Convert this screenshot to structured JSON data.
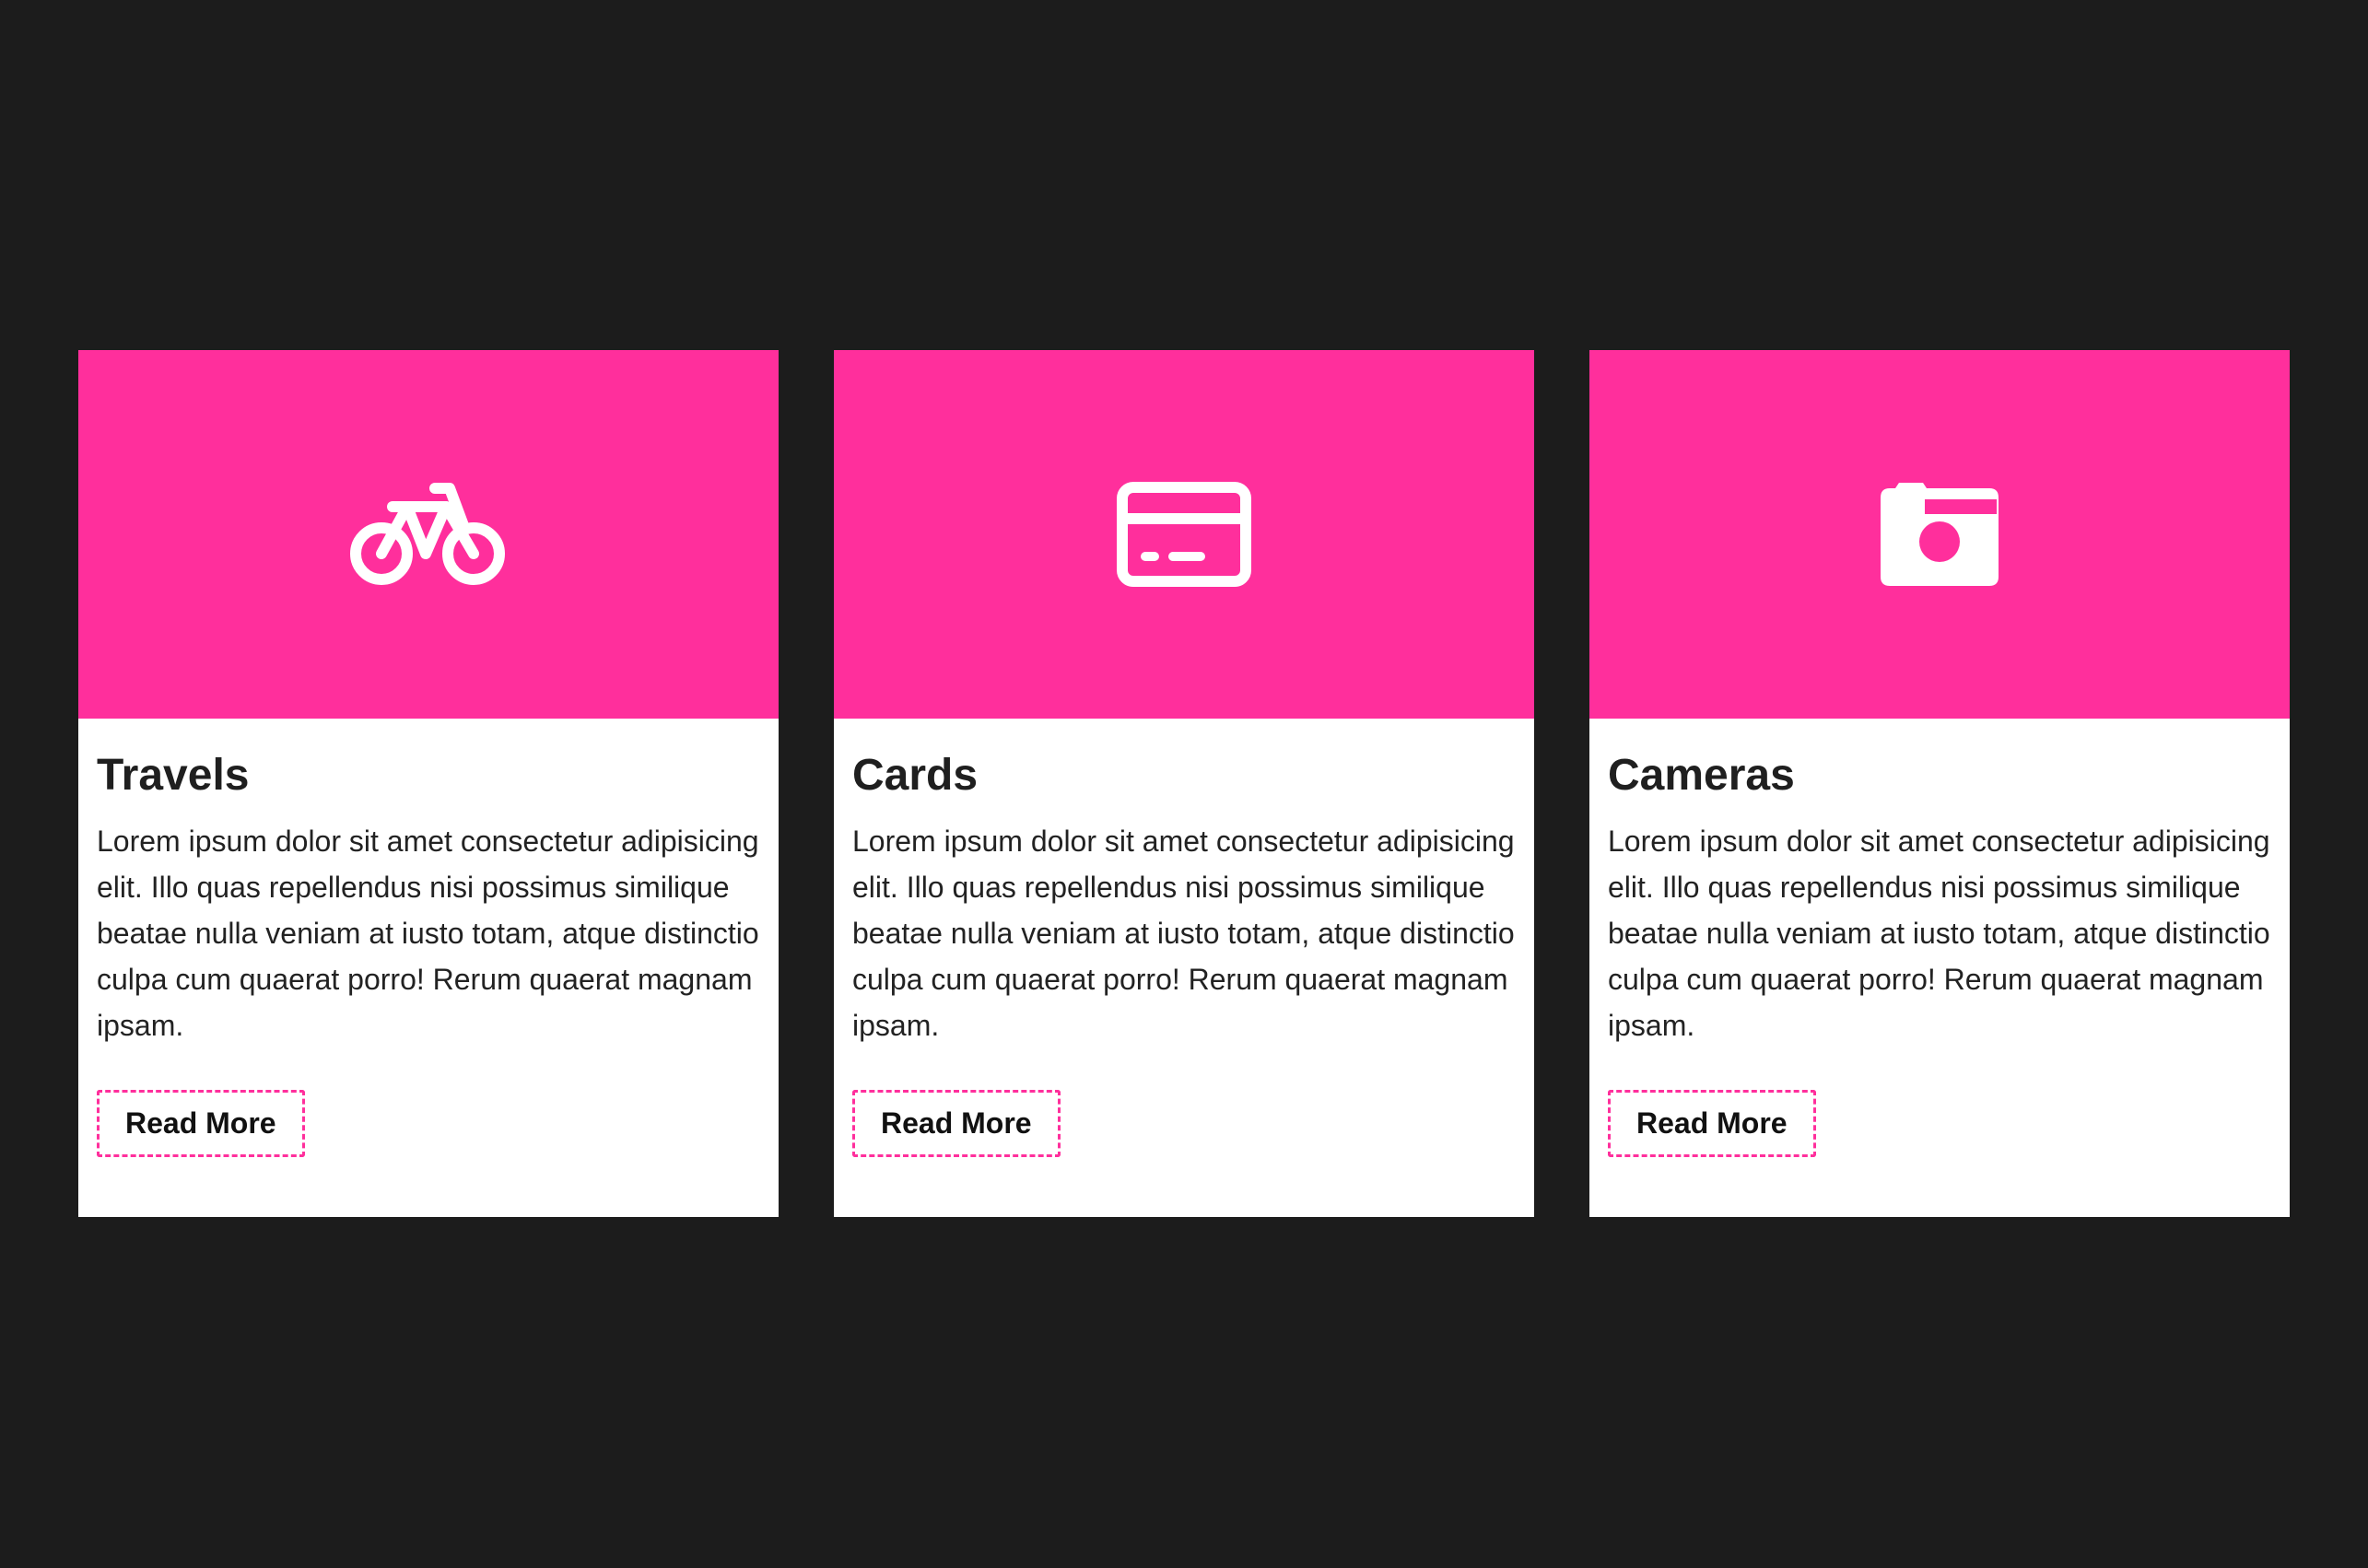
{
  "colors": {
    "background": "#1c1c1c",
    "accent": "#ff2f9c",
    "card_background": "#ffffff"
  },
  "cards": [
    {
      "icon": "bicycle-icon",
      "title": "Travels",
      "text": "Lorem ipsum dolor sit amet consectetur adipisicing elit. Illo quas repellendus nisi possimus similique beatae nulla veniam at iusto totam, atque distinctio culpa cum quaerat porro! Rerum quaerat magnam ipsam.",
      "button_label": "Read More"
    },
    {
      "icon": "credit-card-icon",
      "title": "Cards",
      "text": "Lorem ipsum dolor sit amet consectetur adipisicing elit. Illo quas repellendus nisi possimus similique beatae nulla veniam at iusto totam, atque distinctio culpa cum quaerat porro! Rerum quaerat magnam ipsam.",
      "button_label": "Read More"
    },
    {
      "icon": "camera-icon",
      "title": "Cameras",
      "text": "Lorem ipsum dolor sit amet consectetur adipisicing elit. Illo quas repellendus nisi possimus similique beatae nulla veniam at iusto totam, atque distinctio culpa cum quaerat porro! Rerum quaerat magnam ipsam.",
      "button_label": "Read More"
    }
  ]
}
